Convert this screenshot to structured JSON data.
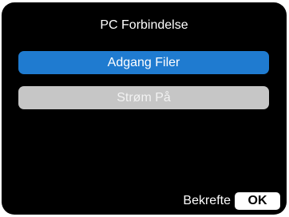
{
  "screen": {
    "title": "PC Forbindelse",
    "menu": [
      {
        "label": "Adgang Filer",
        "selected": true
      },
      {
        "label": "Strøm På",
        "selected": false
      }
    ],
    "footer": {
      "label": "Bekrefte",
      "key": "OK"
    }
  },
  "colors": {
    "background": "#000000",
    "selected": "#1f7bd0",
    "unselected": "#c6c6c6"
  }
}
